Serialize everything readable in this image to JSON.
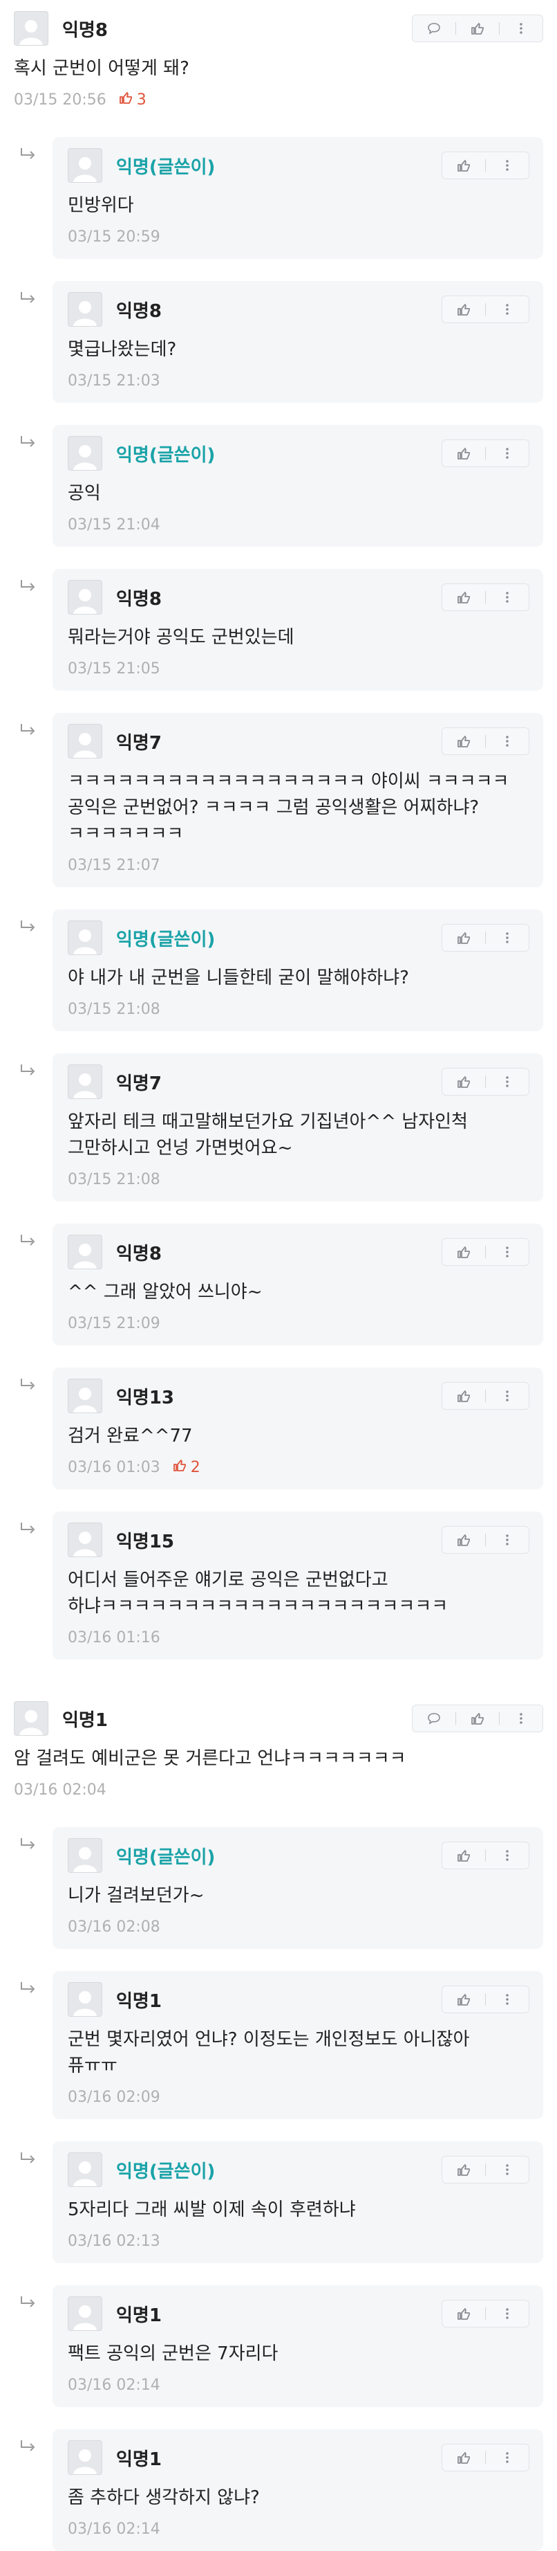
{
  "comments": [
    {
      "id": "c1",
      "type": "top",
      "nick": "익명8",
      "author": false,
      "text": "혹시 군번이 어떻게 돼?",
      "time": "03/15 20:56",
      "likes": "3",
      "show_reply_btn": true
    },
    {
      "id": "c2",
      "type": "reply",
      "nick": "익명(글쓴이)",
      "author": true,
      "text": "민방위다",
      "time": "03/15 20:59"
    },
    {
      "id": "c3",
      "type": "reply",
      "nick": "익명8",
      "author": false,
      "text": "몇급나왔는데?",
      "time": "03/15 21:03"
    },
    {
      "id": "c4",
      "type": "reply",
      "nick": "익명(글쓴이)",
      "author": true,
      "text": "공익",
      "time": "03/15 21:04"
    },
    {
      "id": "c5",
      "type": "reply",
      "nick": "익명8",
      "author": false,
      "text": "뭐라는거야 공익도 군번있는데",
      "time": "03/15 21:05"
    },
    {
      "id": "c6",
      "type": "reply",
      "nick": "익명7",
      "author": false,
      "text": "ㅋㅋㅋㅋㅋㅋㅋㅋㅋㅋㅋㅋㅋㅋㅋㅋㅋㅋ 야이씨 ㅋㅋㅋㅋㅋ\n공익은 군번없어? ㅋㅋㅋㅋ 그럼 공익생활은 어찌하냐?\nㅋㅋㅋㅋㅋㅋㅋ",
      "time": "03/15 21:07"
    },
    {
      "id": "c7",
      "type": "reply",
      "nick": "익명(글쓴이)",
      "author": true,
      "text": "야 내가 내 군번을 니들한테 굳이 말해야하냐?",
      "time": "03/15 21:08"
    },
    {
      "id": "c8",
      "type": "reply",
      "nick": "익명7",
      "author": false,
      "text": "앞자리 테크 때고말해보던가요 기집년아^^ 남자인척\n그만하시고 언넝 가면벗어요~",
      "time": "03/15 21:08"
    },
    {
      "id": "c9",
      "type": "reply",
      "nick": "익명8",
      "author": false,
      "text": "^^ 그래 알았어 쓰니야~",
      "time": "03/15 21:09"
    },
    {
      "id": "c10",
      "type": "reply",
      "nick": "익명13",
      "author": false,
      "text": "검거 완료^^77",
      "time": "03/16 01:03",
      "likes": "2"
    },
    {
      "id": "c11",
      "type": "reply",
      "nick": "익명15",
      "author": false,
      "text": "어디서 들어주운 얘기로 공익은 군번없다고\n하냐ㅋㅋㅋㅋㅋㅋㅋㅋㅋㅋㅋㅋㅋㅋㅋㅋㅋㅋㅋㅋㅋ",
      "time": "03/16 01:16"
    },
    {
      "id": "c12",
      "type": "top",
      "nick": "익명1",
      "author": false,
      "text": "암 걸려도 예비군은 못 거른다고 언냐ㅋㅋㅋㅋㅋㅋㅋ",
      "time": "03/16 02:04",
      "show_reply_btn": true
    },
    {
      "id": "c13",
      "type": "reply",
      "nick": "익명(글쓴이)",
      "author": true,
      "text": "니가 걸려보던가~",
      "time": "03/16 02:08"
    },
    {
      "id": "c14",
      "type": "reply",
      "nick": "익명1",
      "author": false,
      "text": "군번 몇자리였어 언냐? 이정도는 개인정보도 아니잖아\n퓨ㅠㅠ",
      "time": "03/16 02:09"
    },
    {
      "id": "c15",
      "type": "reply",
      "nick": "익명(글쓴이)",
      "author": true,
      "text": "5자리다 그래 씨발 이제 속이 후련하냐",
      "time": "03/16 02:13"
    },
    {
      "id": "c16",
      "type": "reply",
      "nick": "익명1",
      "author": false,
      "text": "팩트 공익의 군번은 7자리다",
      "time": "03/16 02:14"
    },
    {
      "id": "c17",
      "type": "reply",
      "nick": "익명1",
      "author": false,
      "text": "좀 추하다 생각하지 않냐?",
      "time": "03/16 02:14"
    }
  ],
  "colors": {
    "author": "#1aa3a8",
    "like": "#e0533a",
    "meta": "#b0b0b0",
    "bubble": "#f5f6f8"
  },
  "icons": {
    "reply": "speech-bubble-icon",
    "like": "thumbs-up-icon",
    "more": "more-vertical-icon",
    "reply_arrow": "reply-arrow-icon"
  }
}
